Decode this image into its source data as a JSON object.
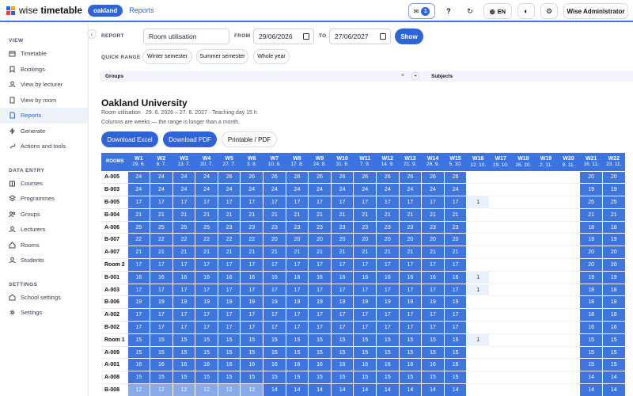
{
  "app": {
    "name_light": "wise",
    "name_bold": "timetable",
    "tenant": "oakland",
    "nav_reports": "Reports"
  },
  "topbar": {
    "notif_count": "1",
    "help": "?",
    "lang": "EN",
    "user": "Wise Administrator"
  },
  "colors": {
    "accent": "#2f64d8",
    "header": "#3b73e0",
    "cell_full": "#3e76de",
    "cell_light": "#eaf0fb"
  },
  "sidebar": {
    "sections": [
      {
        "title": "VIEW",
        "items": [
          {
            "label": "Timetable",
            "icon": "calendar-icon"
          },
          {
            "label": "Bookings",
            "icon": "bookmark-icon"
          },
          {
            "label": "View by lecturer",
            "icon": "person-icon"
          },
          {
            "label": "View by room",
            "icon": "door-icon"
          },
          {
            "label": "Reports",
            "icon": "document-icon",
            "active": true
          },
          {
            "label": "Generate",
            "icon": "bolt-icon"
          },
          {
            "label": "Actions and tools",
            "icon": "wrench-icon"
          }
        ]
      },
      {
        "title": "DATA ENTRY",
        "items": [
          {
            "label": "Courses",
            "icon": "book-icon"
          },
          {
            "label": "Programmes",
            "icon": "layers-icon"
          },
          {
            "label": "Groups",
            "icon": "users-icon"
          },
          {
            "label": "Lecturers",
            "icon": "person-icon"
          },
          {
            "label": "Rooms",
            "icon": "home-icon"
          },
          {
            "label": "Students",
            "icon": "student-icon"
          }
        ]
      },
      {
        "title": "SETTINGS",
        "items": [
          {
            "label": "School settings",
            "icon": "school-icon"
          },
          {
            "label": "Settings",
            "icon": "gear-icon"
          }
        ]
      }
    ]
  },
  "filters": {
    "report_label": "REPORT",
    "report_value": "Room utilisation",
    "from_label": "FROM",
    "from_value": "29/06/2026",
    "to_label": "TO",
    "to_value": "27/06/2027",
    "show_label": "Show",
    "quick_label": "QUICK RANGE",
    "quick_ranges": [
      "Winter semester",
      "Summer semester",
      "Whole year"
    ],
    "groups_label": "Groups",
    "subjects_label": "Subjects"
  },
  "report": {
    "title": "Oakland University",
    "meta": "Room utilisation  ·  29. 6. 2026 – 27. 6. 2027  ·  Teaching day 15 h",
    "note": "Columns are weeks — the range is longer than a month.",
    "buttons": {
      "excel": "Download Excel",
      "pdf": "Download PDF",
      "print": "Printable / PDF"
    }
  },
  "table": {
    "rooms_header": "ROOMS",
    "weeks": [
      {
        "w": "W1",
        "d": "29. 6."
      },
      {
        "w": "W2",
        "d": "6. 7."
      },
      {
        "w": "W3",
        "d": "13. 7."
      },
      {
        "w": "W4",
        "d": "20. 7."
      },
      {
        "w": "W5",
        "d": "27. 7."
      },
      {
        "w": "W6",
        "d": "3. 8."
      },
      {
        "w": "W7",
        "d": "10. 8."
      },
      {
        "w": "W8",
        "d": "17. 8."
      },
      {
        "w": "W9",
        "d": "24. 8."
      },
      {
        "w": "W10",
        "d": "31. 8."
      },
      {
        "w": "W11",
        "d": "7. 9."
      },
      {
        "w": "W12",
        "d": "14. 9."
      },
      {
        "w": "W13",
        "d": "21. 9."
      },
      {
        "w": "W14",
        "d": "28. 9."
      },
      {
        "w": "W15",
        "d": "5. 10."
      },
      {
        "w": "W16",
        "d": "12. 10."
      },
      {
        "w": "W17",
        "d": "19. 10."
      },
      {
        "w": "W18",
        "d": "26. 10."
      },
      {
        "w": "W19",
        "d": "2. 11."
      },
      {
        "w": "W20",
        "d": "9. 11."
      },
      {
        "w": "W21",
        "d": "16. 11."
      },
      {
        "w": "W22",
        "d": "23. 11."
      }
    ],
    "rows": [
      {
        "room": "A-005",
        "v": [
          "24",
          "24",
          "24",
          "24",
          "26",
          "26",
          "26",
          "26",
          "26",
          "26",
          "26",
          "26",
          "26",
          "26",
          "26",
          "",
          "",
          "",
          "",
          "",
          "20",
          "20"
        ]
      },
      {
        "room": "B-003",
        "v": [
          "24",
          "24",
          "24",
          "24",
          "24",
          "24",
          "24",
          "24",
          "24",
          "24",
          "24",
          "24",
          "24",
          "24",
          "24",
          "",
          "",
          "",
          "",
          "",
          "19",
          "19"
        ]
      },
      {
        "room": "B-005",
        "v": [
          "17",
          "17",
          "17",
          "17",
          "17",
          "17",
          "17",
          "17",
          "17",
          "17",
          "17",
          "17",
          "17",
          "17",
          "17",
          "1",
          "",
          "",
          "",
          "",
          "25",
          "25"
        ]
      },
      {
        "room": "B-004",
        "v": [
          "21",
          "21",
          "21",
          "21",
          "21",
          "21",
          "21",
          "21",
          "21",
          "21",
          "21",
          "21",
          "21",
          "21",
          "21",
          "",
          "",
          "",
          "",
          "",
          "21",
          "21"
        ]
      },
      {
        "room": "A-006",
        "v": [
          "25",
          "25",
          "25",
          "25",
          "23",
          "23",
          "23",
          "23",
          "23",
          "23",
          "23",
          "23",
          "23",
          "23",
          "23",
          "",
          "",
          "",
          "",
          "",
          "18",
          "18"
        ]
      },
      {
        "room": "B-007",
        "v": [
          "22",
          "22",
          "22",
          "22",
          "22",
          "22",
          "20",
          "20",
          "20",
          "20",
          "20",
          "20",
          "20",
          "20",
          "20",
          "",
          "",
          "",
          "",
          "",
          "19",
          "19"
        ]
      },
      {
        "room": "A-007",
        "v": [
          "21",
          "21",
          "21",
          "21",
          "21",
          "21",
          "21",
          "21",
          "21",
          "21",
          "21",
          "21",
          "21",
          "21",
          "21",
          "",
          "",
          "",
          "",
          "",
          "20",
          "20"
        ]
      },
      {
        "room": "Room 2",
        "v": [
          "17",
          "17",
          "17",
          "17",
          "17",
          "17",
          "17",
          "17",
          "17",
          "17",
          "17",
          "17",
          "17",
          "17",
          "17",
          "",
          "",
          "",
          "",
          "",
          "20",
          "20"
        ]
      },
      {
        "room": "B-001",
        "v": [
          "16",
          "16",
          "16",
          "16",
          "16",
          "16",
          "16",
          "16",
          "16",
          "16",
          "16",
          "16",
          "16",
          "16",
          "16",
          "1",
          "",
          "",
          "",
          "",
          "19",
          "19"
        ]
      },
      {
        "room": "A-003",
        "v": [
          "17",
          "17",
          "17",
          "17",
          "17",
          "17",
          "17",
          "17",
          "17",
          "17",
          "17",
          "17",
          "17",
          "17",
          "17",
          "1",
          "",
          "",
          "",
          "",
          "18",
          "18"
        ]
      },
      {
        "room": "B-006",
        "v": [
          "19",
          "19",
          "19",
          "19",
          "19",
          "19",
          "19",
          "19",
          "19",
          "19",
          "19",
          "19",
          "19",
          "19",
          "19",
          "",
          "",
          "",
          "",
          "",
          "18",
          "18"
        ]
      },
      {
        "room": "A-002",
        "v": [
          "17",
          "17",
          "17",
          "17",
          "17",
          "17",
          "17",
          "17",
          "17",
          "17",
          "17",
          "17",
          "17",
          "17",
          "17",
          "",
          "",
          "",
          "",
          "",
          "18",
          "18"
        ]
      },
      {
        "room": "B-002",
        "v": [
          "17",
          "17",
          "17",
          "17",
          "17",
          "17",
          "17",
          "17",
          "17",
          "17",
          "17",
          "17",
          "17",
          "17",
          "17",
          "",
          "",
          "",
          "",
          "",
          "16",
          "16"
        ]
      },
      {
        "room": "Room 1",
        "v": [
          "15",
          "15",
          "15",
          "15",
          "15",
          "15",
          "15",
          "15",
          "15",
          "15",
          "15",
          "15",
          "15",
          "15",
          "15",
          "1",
          "",
          "",
          "",
          "",
          "15",
          "15"
        ]
      },
      {
        "room": "A-009",
        "v": [
          "15",
          "15",
          "15",
          "15",
          "15",
          "15",
          "15",
          "15",
          "15",
          "15",
          "15",
          "15",
          "15",
          "15",
          "15",
          "",
          "",
          "",
          "",
          "",
          "15",
          "15"
        ]
      },
      {
        "room": "A-001",
        "v": [
          "16",
          "16",
          "16",
          "16",
          "16",
          "16",
          "16",
          "16",
          "16",
          "16",
          "16",
          "16",
          "16",
          "16",
          "16",
          "",
          "",
          "",
          "",
          "",
          "15",
          "15"
        ]
      },
      {
        "room": "A-008",
        "v": [
          "15",
          "15",
          "15",
          "15",
          "15",
          "15",
          "15",
          "15",
          "15",
          "15",
          "15",
          "15",
          "15",
          "15",
          "15",
          "",
          "",
          "",
          "",
          "",
          "14",
          "14"
        ]
      },
      {
        "room": "B-008",
        "v": [
          "12",
          "12",
          "12",
          "12",
          "12",
          "12",
          "14",
          "14",
          "14",
          "14",
          "14",
          "14",
          "14",
          "14",
          "14",
          "",
          "",
          "",
          "",
          "",
          "14",
          "14"
        ]
      }
    ]
  }
}
